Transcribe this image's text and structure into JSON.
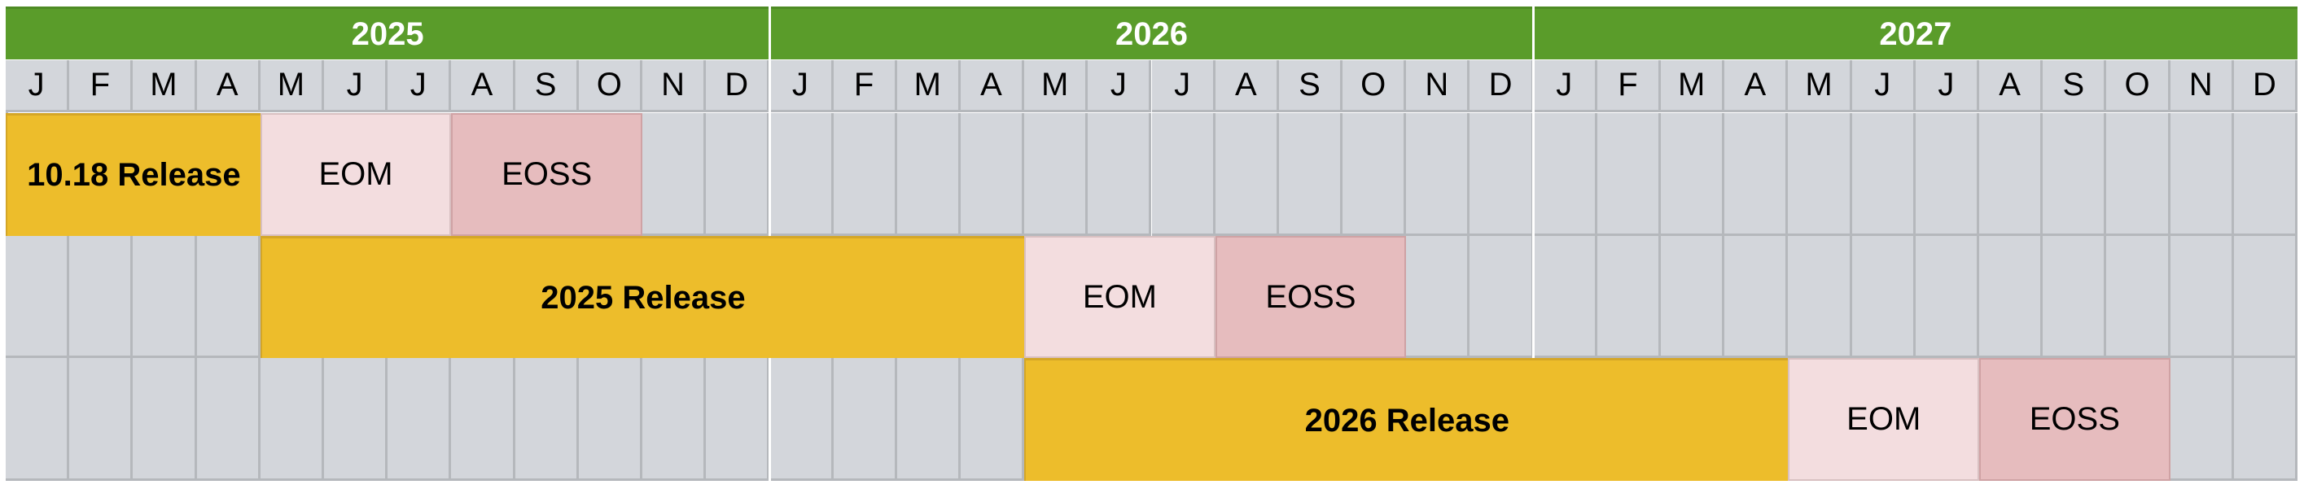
{
  "chart_data": {
    "type": "gantt",
    "title": "",
    "years": [
      "2025",
      "2026",
      "2027"
    ],
    "months": [
      "J",
      "F",
      "M",
      "A",
      "M",
      "J",
      "J",
      "A",
      "S",
      "O",
      "N",
      "D"
    ],
    "colors": {
      "header": "#5a9c2a",
      "grid": "#d3d6db",
      "release": "#edbd2b",
      "eom": "#f3dddf",
      "eoss": "#e6bcbe"
    },
    "rows": [
      {
        "name": "10.18",
        "segments": [
          {
            "label": "10.18 Release",
            "kind": "release",
            "start": "2025-01",
            "end": "2025-04",
            "start_index": 0,
            "months": 4
          },
          {
            "label": "EOM",
            "kind": "eom",
            "start": "2025-05",
            "end": "2025-07",
            "start_index": 4,
            "months": 3
          },
          {
            "label": "EOSS",
            "kind": "eoss",
            "start": "2025-08",
            "end": "2025-10",
            "start_index": 7,
            "months": 3
          }
        ]
      },
      {
        "name": "2025",
        "segments": [
          {
            "label": "2025 Release",
            "kind": "release",
            "start": "2025-05",
            "end": "2026-04",
            "start_index": 4,
            "months": 12
          },
          {
            "label": "EOM",
            "kind": "eom",
            "start": "2026-05",
            "end": "2026-07",
            "start_index": 16,
            "months": 3
          },
          {
            "label": "EOSS",
            "kind": "eoss",
            "start": "2026-08",
            "end": "2026-10",
            "start_index": 19,
            "months": 3
          }
        ]
      },
      {
        "name": "2026",
        "segments": [
          {
            "label": "2026 Release",
            "kind": "release",
            "start": "2026-05",
            "end": "2027-04",
            "start_index": 16,
            "months": 12
          },
          {
            "label": "EOM",
            "kind": "eom",
            "start": "2027-05",
            "end": "2027-07",
            "start_index": 28,
            "months": 3
          },
          {
            "label": "EOSS",
            "kind": "eoss",
            "start": "2027-08",
            "end": "2027-10",
            "start_index": 31,
            "months": 3
          }
        ]
      }
    ]
  }
}
